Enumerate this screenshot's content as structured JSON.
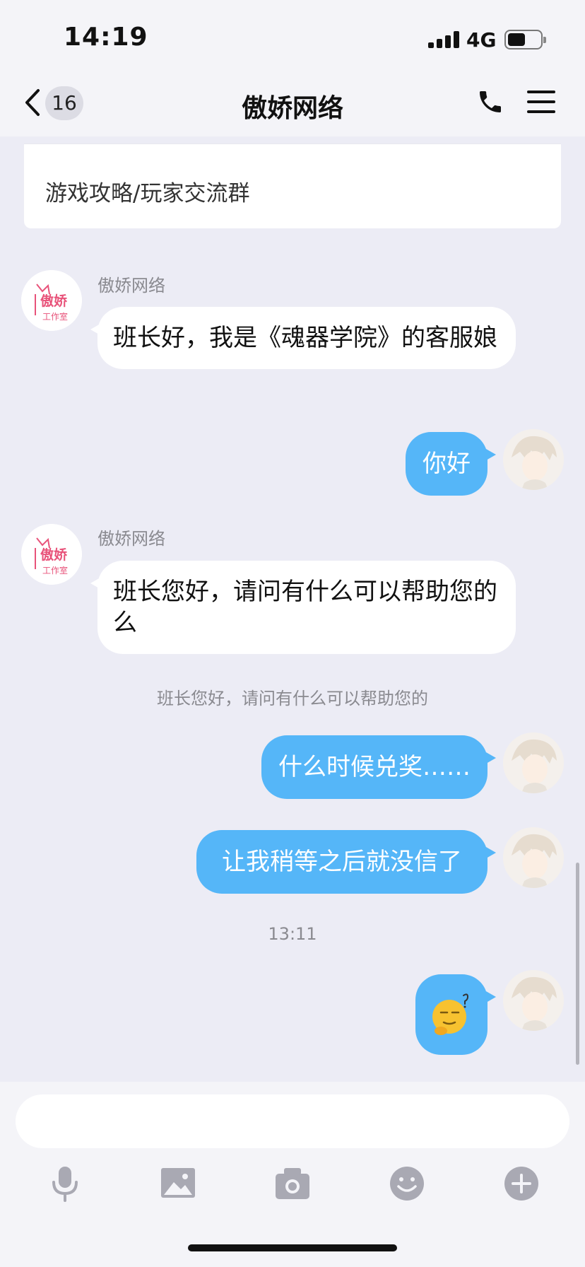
{
  "status": {
    "time": "14:19",
    "network": "4G"
  },
  "header": {
    "unread_count": "16",
    "title": "傲娇网络"
  },
  "pinned_card": {
    "text": "游戏攻略/玩家交流群"
  },
  "messages": [
    {
      "side": "in",
      "sender": "傲娇网络",
      "text": "班长好，我是《魂器学院》的客服娘"
    },
    {
      "side": "out",
      "text": "你好"
    },
    {
      "side": "in",
      "sender": "傲娇网络",
      "text": "班长您好，请问有什么可以帮助您的么"
    },
    {
      "side": "system",
      "text": "班长您好，请问有什么可以帮助您的"
    },
    {
      "side": "out",
      "text": "什么时候兑奖……"
    },
    {
      "side": "out",
      "text": "让我稍等之后就没信了"
    },
    {
      "side": "time",
      "text": "13:11"
    },
    {
      "side": "out",
      "emoji": "sleepy-face-emoji"
    }
  ],
  "brand_avatar": {
    "line1": "傲娇",
    "line2": "工作室"
  },
  "input": {
    "placeholder": ""
  },
  "toolbar": [
    "microphone-icon",
    "image-icon",
    "camera-icon",
    "emoji-icon",
    "plus-icon"
  ],
  "colors": {
    "outgoing_bubble": "#55b6f8",
    "incoming_bubble": "#ffffff",
    "background": "#ececf5",
    "brand_pink": "#e8537a"
  }
}
